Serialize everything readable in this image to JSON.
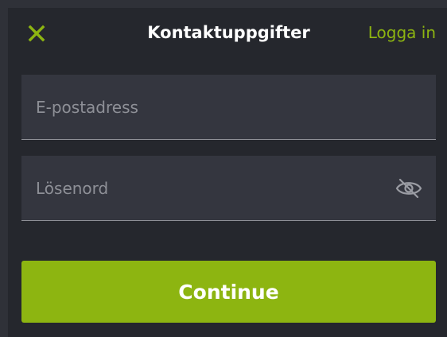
{
  "header": {
    "close_icon": "close-icon",
    "title": "Kontaktuppgifter",
    "login_label": "Logga in"
  },
  "form": {
    "email": {
      "value": "",
      "placeholder": "E-postadress"
    },
    "password": {
      "value": "",
      "placeholder": "Lösenord",
      "toggle_icon": "eye-off-icon"
    },
    "continue_label": "Continue"
  },
  "colors": {
    "accent": "#8db511",
    "panel": "#25272d",
    "field": "#34363f",
    "outer": "#2f3138"
  }
}
